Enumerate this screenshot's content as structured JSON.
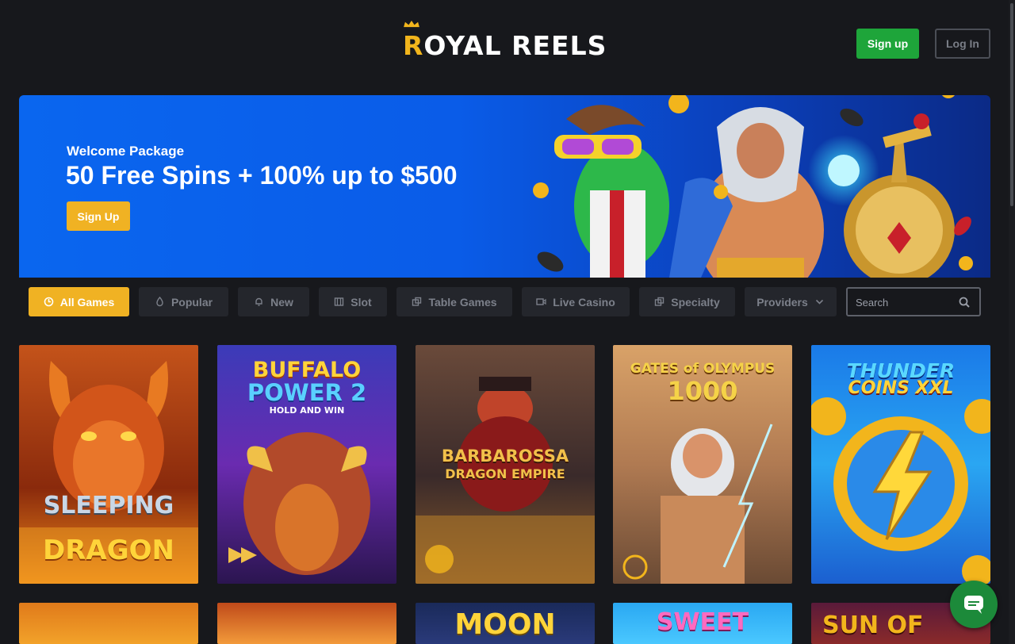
{
  "header": {
    "logo_first": "R",
    "logo_rest": "OYAL REELS",
    "signup_label": "Sign up",
    "login_label": "Log In"
  },
  "banner": {
    "kicker": "Welcome Package",
    "headline": "50 Free Spins + 100% up to $500",
    "cta_label": "Sign Up"
  },
  "filters": {
    "items": [
      {
        "label": "All Games",
        "icon": "clock-icon",
        "active": true
      },
      {
        "label": "Popular",
        "icon": "flame-icon",
        "active": false
      },
      {
        "label": "New",
        "icon": "bell-icon",
        "active": false
      },
      {
        "label": "Slot",
        "icon": "slot-machine-icon",
        "active": false
      },
      {
        "label": "Table Games",
        "icon": "dice-icon",
        "active": false
      },
      {
        "label": "Live Casino",
        "icon": "video-icon",
        "active": false
      },
      {
        "label": "Specialty",
        "icon": "dice-icon",
        "active": false
      },
      {
        "label": "Providers",
        "icon": "chevron-down-icon",
        "active": false
      }
    ],
    "search_placeholder": "Search"
  },
  "games": [
    {
      "line1": "SLEEPING",
      "line2": "DRAGON"
    },
    {
      "line1": "BUFFALO",
      "line2": "POWER 2",
      "line3": "HOLD AND WIN"
    },
    {
      "line1": "BARBAROSSA",
      "line2": "DRAGON EMPIRE"
    },
    {
      "line1": "GATES of OLYMPUS",
      "line2": "1000"
    },
    {
      "line1": "THUNDER",
      "line2": "COINS XXL"
    }
  ],
  "games_row2": [
    {
      "line1": ""
    },
    {
      "line1": ""
    },
    {
      "line1": "MOON"
    },
    {
      "line1": "SWEET"
    },
    {
      "line1": "SUN OF"
    }
  ],
  "colors": {
    "background": "#17181c",
    "accent": "#f0b223",
    "signup_green": "#1ea53a",
    "banner_blue": "#0a66ef"
  }
}
